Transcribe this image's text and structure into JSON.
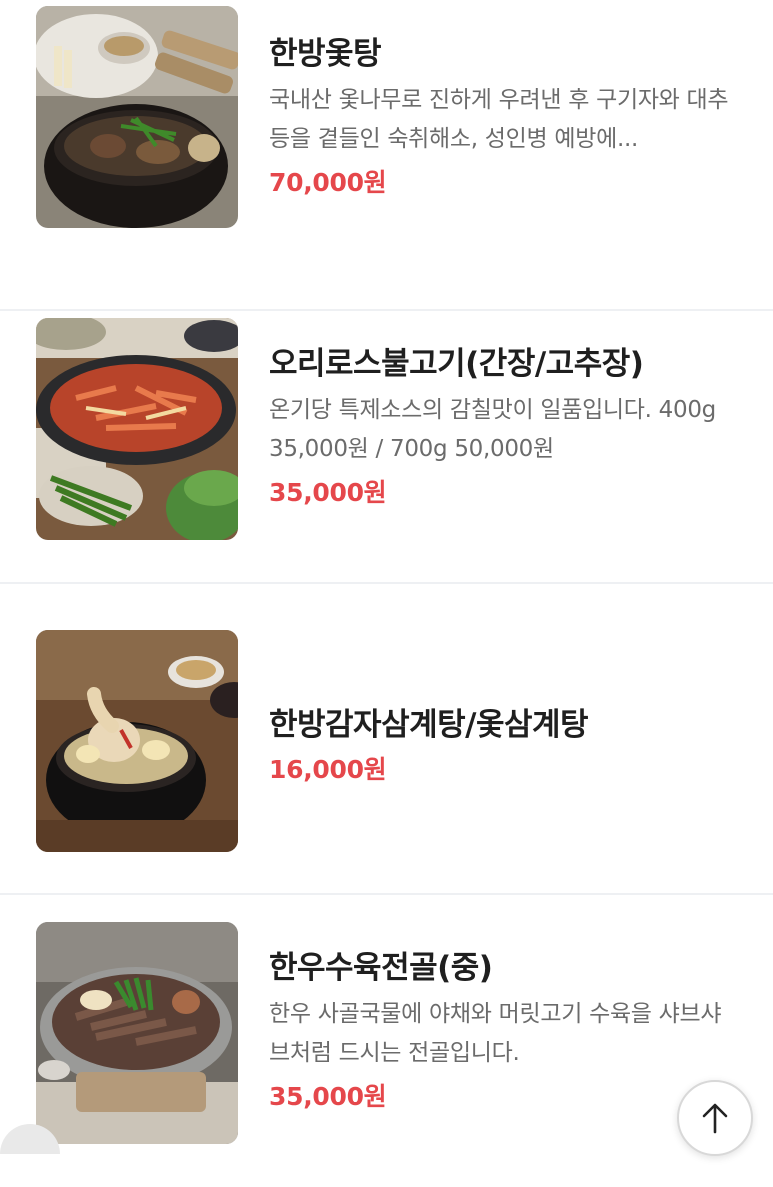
{
  "menu": {
    "items": [
      {
        "name": "한방옻탕",
        "description": "국내산 옻나무로 진하게 우려낸 후 구기자와 대추 등을 곁들인 숙취해소, 성인병 예방에...",
        "price": "70,000원",
        "image_icon": "herbal-lacquer-soup-photo"
      },
      {
        "name": "오리로스불고기(간장/고추장)",
        "description": "온기당 특제소스의 감칠맛이 일품입니다. 400g 35,000원 / 700g 50,000원",
        "price": "35,000원",
        "image_icon": "duck-bulgogi-photo"
      },
      {
        "name": "한방감자삼계탕/옻삼계탕",
        "description": "",
        "price": "16,000원",
        "image_icon": "samgyetang-photo"
      },
      {
        "name": "한우수육전골(중)",
        "description": "한우 사골국물에 야채와 머릿고기 수육을 샤브샤브처럼 드시는 전골입니다.",
        "price": "35,000원",
        "image_icon": "hanwoo-hotpot-photo"
      }
    ]
  },
  "scroll_top": {
    "icon": "arrow-up-icon"
  },
  "colors": {
    "price": "#e5474b",
    "title": "#1f1f1f",
    "description": "#6b6b6b",
    "divider": "#eef0f3"
  }
}
